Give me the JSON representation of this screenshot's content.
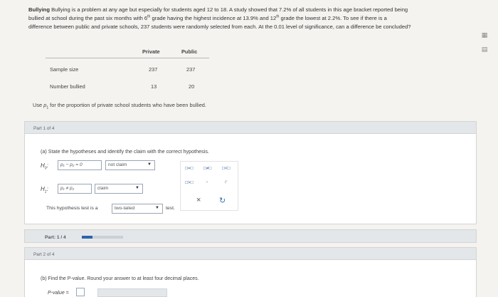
{
  "problem": {
    "title": "Bullying",
    "line1": "Bullying is a problem at any age but especially for students aged 12 to 18. A study showed that 7.2% of all students in this age bracket reported being",
    "line2a": "bullied at school during the past six months with 6",
    "sup1": "th",
    "line2b": " grade having the highest incidence at 13.9% and 12",
    "sup2": "th",
    "line2c": " grade the lowest at 2.2%. To see if there is a",
    "line3": "difference between public and private schools, 237 students were randomly selected from each. At the 0.01 level of significance, can a difference be concluded?"
  },
  "table": {
    "headers": [
      "Private",
      "Public"
    ],
    "rows": [
      {
        "label": "Sample size",
        "private": "237",
        "public": "237"
      },
      {
        "label": "Number bullied",
        "private": "13",
        "public": "20"
      }
    ]
  },
  "use_line": {
    "prefix": "Use ",
    "var": "p",
    "sub": "1",
    "suffix": " for the proportion of private school students who have been bullied."
  },
  "part1": {
    "header": "Part 1 of 4",
    "title": "(a) State the hypotheses and identify the claim with the correct hypothesis.",
    "h0": {
      "symbol": "H",
      "sub": "0",
      "expr": "p₁ − p₂ = 0",
      "claim_select": "not claim"
    },
    "h1": {
      "symbol": "H",
      "sub": "1",
      "expr": "p₁ ≠ p₂",
      "claim_select": "claim"
    },
    "test_prefix": "This hypothesis test is a",
    "test_select": "two-tailed",
    "test_suffix": "test."
  },
  "palette": {
    "row1": [
      "□=□",
      "□≠□",
      "□<□"
    ],
    "row2": [
      "□>□",
      "ⁿ",
      "ᵖ̂"
    ],
    "clear": "×",
    "undo": "↻"
  },
  "progress": {
    "label": "Part: 1 / 4",
    "fraction": 0.25,
    "accent": "#2f63a8"
  },
  "part2": {
    "header": "Part 2 of 4",
    "title": "(b) Find the P-value. Round your answer to at least four decimal places.",
    "pvalue_label": "P-value ="
  },
  "tools": {
    "icon1": "calculator-icon",
    "icon2": "data-icon"
  }
}
